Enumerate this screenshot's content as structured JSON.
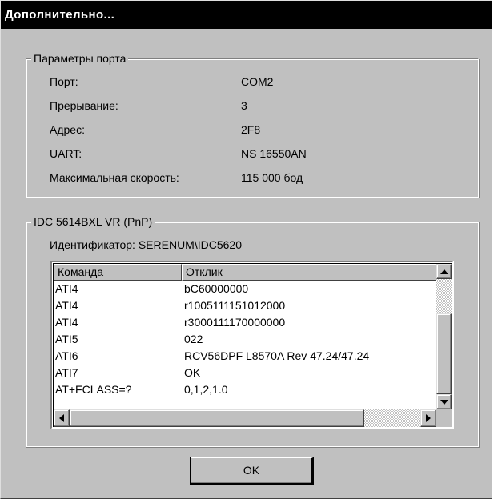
{
  "window": {
    "title": "Дополнительно..."
  },
  "port_group": {
    "legend": "Параметры порта",
    "rows": [
      {
        "label": "Порт:",
        "value": "COM2"
      },
      {
        "label": "Прерывание:",
        "value": "3"
      },
      {
        "label": "Адрес:",
        "value": "2F8"
      },
      {
        "label": "UART:",
        "value": "NS 16550AN"
      },
      {
        "label": "Максимальная скорость:",
        "value": "115 000 бод"
      }
    ]
  },
  "device_group": {
    "legend": "IDC 5614BXL VR (PnP)",
    "identifier": "Идентификатор: SERENUM\\IDC5620",
    "table": {
      "columns": [
        "Команда",
        "Отклик"
      ],
      "rows": [
        [
          "ATI4",
          "bC60000000"
        ],
        [
          "ATI4",
          "r1005111151012000"
        ],
        [
          "ATI4",
          "r3000111170000000"
        ],
        [
          "ATI5",
          "022"
        ],
        [
          "ATI6",
          "RCV56DPF L8570A Rev 47.24/47.24"
        ],
        [
          "ATI7",
          "OK"
        ],
        [
          "AT+FCLASS=?",
          "0,1,2,1.0"
        ]
      ]
    }
  },
  "buttons": {
    "ok": "OK"
  },
  "colors": {
    "face": "#c0c0c0",
    "titlebar": "#000000",
    "title_text": "#ffffff"
  }
}
